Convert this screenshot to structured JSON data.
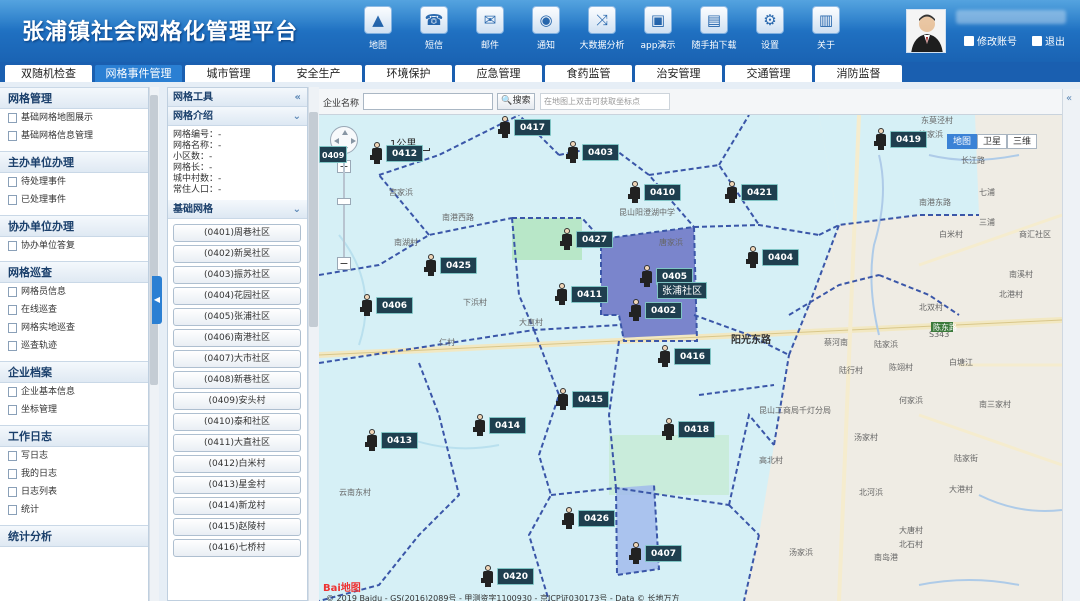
{
  "header": {
    "title": "张浦镇社会网格化管理平台",
    "icons": [
      {
        "label": "地图",
        "icon": "map-icon",
        "glyph": "▲"
      },
      {
        "label": "短信",
        "icon": "phone-icon",
        "glyph": "☎"
      },
      {
        "label": "邮件",
        "icon": "mail-icon",
        "glyph": "✉"
      },
      {
        "label": "通知",
        "icon": "speaker-icon",
        "glyph": "◉"
      },
      {
        "label": "大数据分析",
        "icon": "shuffle-icon",
        "glyph": "⤨"
      },
      {
        "label": "app演示",
        "icon": "app-window-icon",
        "glyph": "▣"
      },
      {
        "label": "随手拍下载",
        "icon": "download-window-icon",
        "glyph": "▤"
      },
      {
        "label": "设置",
        "icon": "gear-icon",
        "glyph": "⚙"
      },
      {
        "label": "关于",
        "icon": "bar-chart-icon",
        "glyph": "▥"
      }
    ],
    "modify_account": "修改账号",
    "logout": "退出"
  },
  "tabs": [
    {
      "label": "双随机检查",
      "active": false
    },
    {
      "label": "网格事件管理",
      "active": true
    },
    {
      "label": "城市管理",
      "active": false
    },
    {
      "label": "安全生产",
      "active": false
    },
    {
      "label": "环境保护",
      "active": false
    },
    {
      "label": "应急管理",
      "active": false
    },
    {
      "label": "食药监管",
      "active": false
    },
    {
      "label": "治安管理",
      "active": false
    },
    {
      "label": "交通管理",
      "active": false
    },
    {
      "label": "消防监督",
      "active": false
    }
  ],
  "sidebar": {
    "sections": [
      {
        "title": "网格管理",
        "items": [
          "基础网格地图展示",
          "基础网格信息管理"
        ]
      },
      {
        "title": "主办单位办理",
        "items": [
          "待处理事件",
          "已处理事件"
        ]
      },
      {
        "title": "协办单位办理",
        "items": [
          "协办单位答复"
        ]
      },
      {
        "title": "网格巡查",
        "items": [
          "网格员信息",
          "在线巡查",
          "网格实地巡查",
          "巡查轨迹"
        ]
      },
      {
        "title": "企业档案",
        "items": [
          "企业基本信息",
          "坐标管理"
        ]
      },
      {
        "title": "工作日志",
        "items": [
          "写日志",
          "我的日志",
          "日志列表",
          "统计"
        ]
      },
      {
        "title": "统计分析",
        "items": []
      }
    ]
  },
  "panel": {
    "title": "网格工具",
    "intro_title": "网格介绍",
    "info_lines": [
      "网格编号：-",
      "网格名称：-",
      "小区数：-",
      "网格长：-",
      "城中村数：-",
      "常住人口：-"
    ],
    "basic_title": "基础网格",
    "grid_buttons": [
      "(0401)周巷社区",
      "(0402)新昊社区",
      "(0403)振苏社区",
      "(0404)花园社区",
      "(0405)张浦社区",
      "(0406)南港社区",
      "(0407)大市社区",
      "(0408)新巷社区",
      "(0409)安头村",
      "(0410)泰和社区",
      "(0411)大直社区",
      "(0412)白米村",
      "(0413)星金村",
      "(0414)新龙村",
      "(0415)赵陵村",
      "(0416)七桥村"
    ]
  },
  "search": {
    "label": "企业名称",
    "button": "搜索",
    "hint": "在地图上双击可获取坐标点"
  },
  "map": {
    "scale": "1公里",
    "types": [
      "地图",
      "卫星",
      "三维"
    ],
    "active_type": "地图",
    "brand": "Bai地图",
    "copyright": "© 2019 Baidu - GS(2016)2089号 - 甲测资字1100930 - 京ICP证030173号 - Data © 长地万方",
    "highlight_label": "张浦社区",
    "markers": [
      "0417",
      "0412",
      "0403",
      "0419",
      "0410",
      "0421",
      "0427",
      "0425",
      "0404",
      "0405",
      "0411",
      "0402",
      "0406",
      "0416",
      "0415",
      "0414",
      "0418",
      "0413",
      "0426",
      "0407",
      "0420",
      "0409"
    ],
    "place_labels": [
      "东莫泾村",
      "百灵路",
      "宫家浜",
      "南湖村",
      "沈家浜",
      "长江路",
      "新巷",
      "前村",
      "南港西路",
      "新巷泾村",
      "下浜村",
      "大直村",
      "唐家浜",
      "昆山阳澄湖中学",
      "七浦",
      "三浦",
      "南溪村",
      "北港村",
      "高墩",
      "新村",
      "新南村",
      "曹巷",
      "蔡河南",
      "北双村",
      "陆家浜",
      "陈翊村",
      "陆行村",
      "何家浜",
      "白塘江",
      "东江口",
      "昆山工商局千灯分局",
      "南三家村",
      "汤家村",
      "苏家村",
      "高北村",
      "陆家街",
      "大路村",
      "北河浜",
      "朱家浜",
      "大港村",
      "大唐村",
      "南岛港",
      "北石村",
      "水晶村",
      "东溪港",
      "诸浦",
      "云南东村",
      "汤家浜",
      "南港东路",
      "白米村",
      "商汇社区",
      "黄巷村",
      "仁村",
      "潭港浜",
      "江浦",
      "浦南",
      "戴舍",
      "长路",
      "七浦塘",
      "江港",
      "丰北",
      "S343",
      "陈东路",
      "七浦家"
    ],
    "roads": [
      "阳光东路",
      "商汇社区"
    ]
  },
  "colors": {
    "header_top": "#2f8fd8",
    "header_bottom": "#1a63b3",
    "tab_active": "#2a7fd3",
    "grid_fill": "#d6f0f6",
    "grid_border": "#3a56a8",
    "highlight_fill": "#6a72c4",
    "marker_label": "#1f3f4f"
  }
}
